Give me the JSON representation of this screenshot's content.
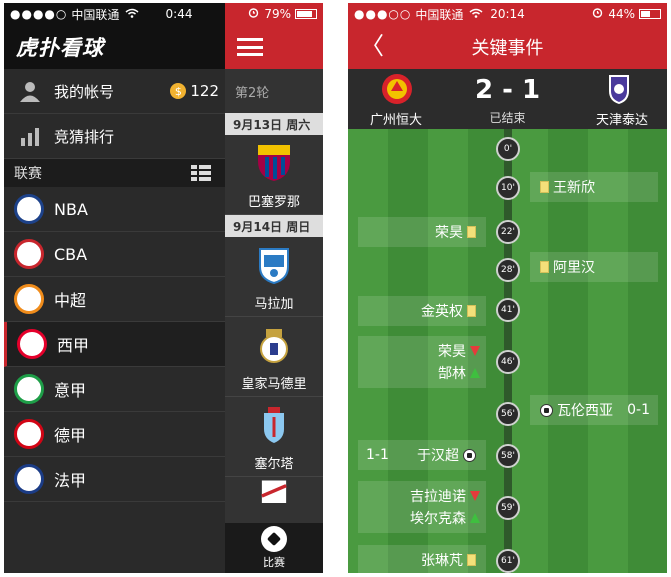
{
  "left": {
    "status": {
      "signal": "●●●●○",
      "carrier": "中国联通",
      "time": "0:44",
      "battery": "79%"
    },
    "brand": "虎扑看球",
    "account": {
      "label": "我的帐号",
      "coins": "122",
      "coin_symbol": "$"
    },
    "ranking_label": "竞猜排行",
    "league_header": "联赛",
    "leagues": [
      {
        "name": "NBA",
        "color": "#1d428a"
      },
      {
        "name": "CBA",
        "color": "#c8262d"
      },
      {
        "name": "中超",
        "color": "#f08c1b"
      },
      {
        "name": "西甲",
        "color": "#e4002b",
        "active": true
      },
      {
        "name": "意甲",
        "color": "#1e9e48"
      },
      {
        "name": "德甲",
        "color": "#d20515"
      },
      {
        "name": "法甲",
        "color": "#1b3c86"
      }
    ],
    "fixtures": {
      "round": "第2轮",
      "dates": [
        "9月13日 周六",
        "9月14日 周日"
      ],
      "teams": [
        "巴塞罗那",
        "马拉加",
        "皇家马德里",
        "塞尔塔"
      ]
    },
    "tab_label": "比赛"
  },
  "right": {
    "status": {
      "signal": "●●●○○",
      "carrier": "中国联通",
      "time": "20:14",
      "battery": "44%"
    },
    "nav_title": "关键事件",
    "back": "〈",
    "home_team": "广州恒大",
    "away_team": "天津泰达",
    "score": "2 - 1",
    "state": "已结束",
    "minutes": [
      "0'",
      "10'",
      "22'",
      "28'",
      "41'",
      "46'",
      "56'",
      "58'",
      "59'",
      "61'"
    ],
    "events": {
      "e10": "王新欣",
      "e22": "荣昊",
      "e28": "阿里汉",
      "e41": "金英权",
      "e46_out": "荣昊",
      "e46_in": "郜林",
      "e56_name": "瓦伦西亚",
      "e56_score": "0-1",
      "e58_name": "于汉超",
      "e58_score": "1-1",
      "e59_out": "吉拉迪诺",
      "e59_in": "埃尔克森",
      "e61": "张琳芃"
    }
  }
}
